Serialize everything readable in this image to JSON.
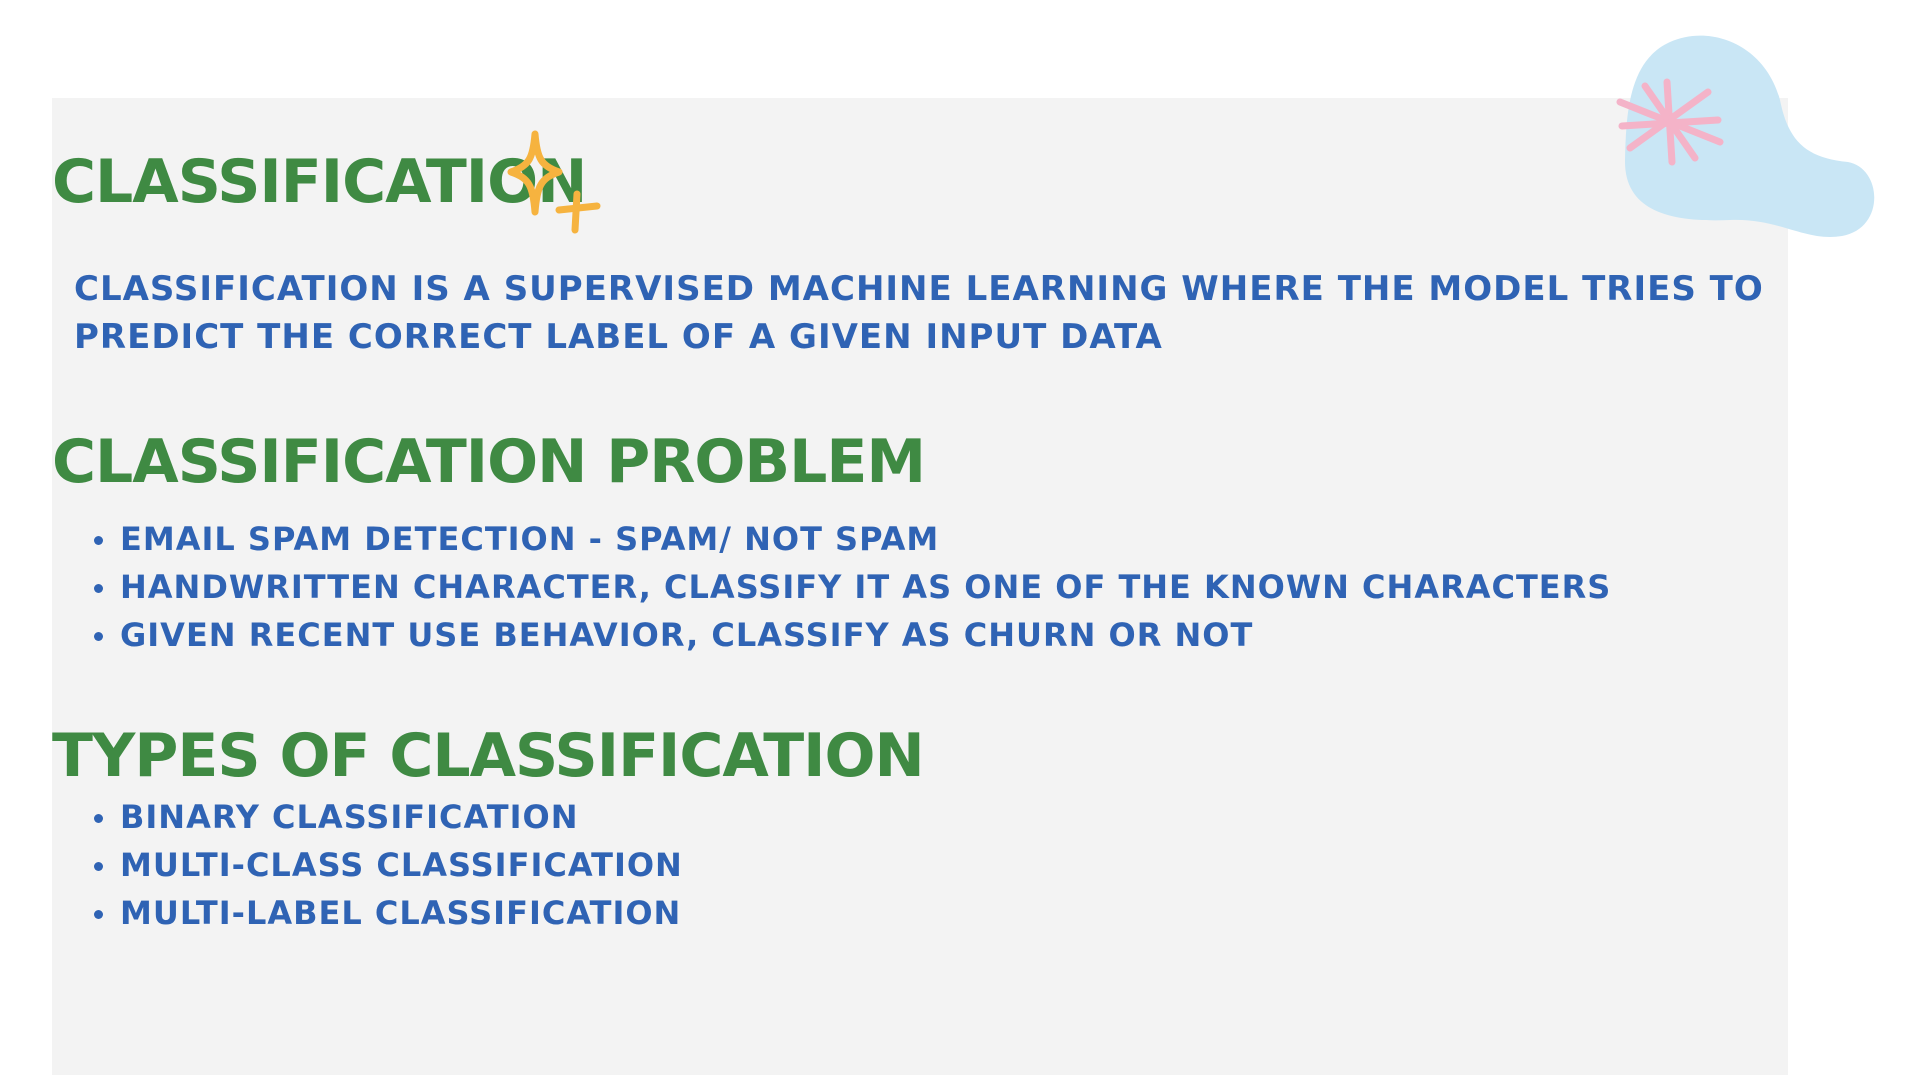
{
  "sections": {
    "classification": {
      "title": "CLASSIFICATION",
      "description": "CLASSIFICATION IS A SUPERVISED MACHINE LEARNING WHERE THE MODEL TRIES TO PREDICT THE CORRECT LABEL OF A GIVEN INPUT DATA"
    },
    "problem": {
      "title": "CLASSIFICATION PROBLEM",
      "items": [
        "EMAIL SPAM DETECTION - SPAM/ NOT SPAM",
        "HANDWRITTEN CHARACTER, CLASSIFY IT AS ONE OF THE KNOWN CHARACTERS",
        "GIVEN RECENT USE BEHAVIOR, CLASSIFY AS CHURN OR NOT"
      ]
    },
    "types": {
      "title": "TYPES OF CLASSIFICATION",
      "items": [
        "BINARY CLASSIFICATION",
        "MULTI-CLASS CLASSIFICATION",
        "MULTI-LABEL CLASSIFICATION"
      ]
    }
  },
  "decorations": {
    "sparkle_icon": "sparkle-icon",
    "sparkle_color": "#f6b33f",
    "blob_icon": "blob-shape",
    "blob_color": "#c9e6f5",
    "asterisk_icon": "asterisk-icon",
    "asterisk_color": "#f4b3c8"
  },
  "colors": {
    "heading": "#3f8a43",
    "body_text": "#2f63b4",
    "panel": "#f3f3f3"
  }
}
